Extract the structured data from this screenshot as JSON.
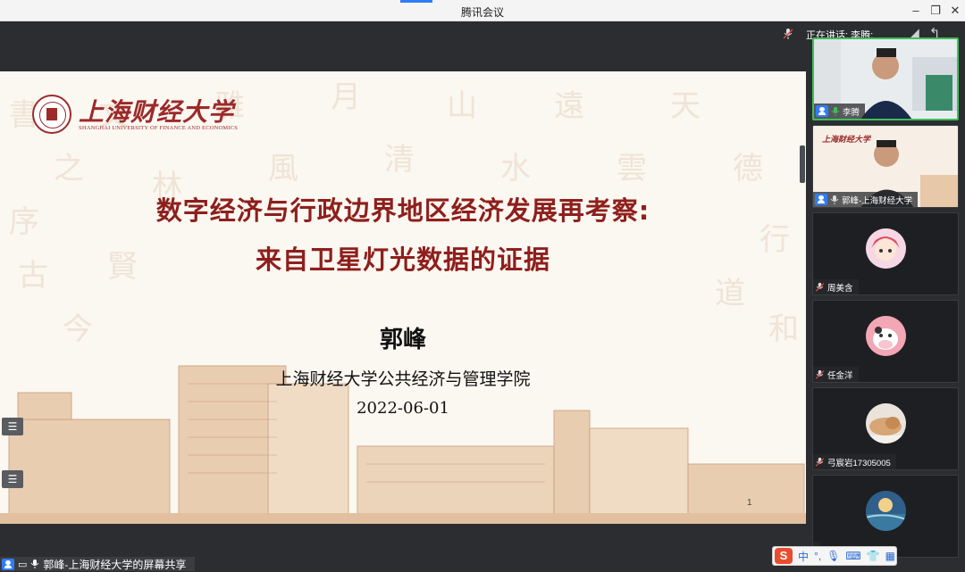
{
  "window": {
    "title": "腾讯会议"
  },
  "toolbar": {
    "speaking_label": "正在讲话: 李腾;"
  },
  "slide": {
    "logo_cn": "上海财经大学",
    "logo_en": "SHANGHAI UNIVERSITY OF FINANCE AND ECONOMICS",
    "title_line1": "数字经济与行政边界地区经济发展再考察:",
    "title_line2": "来自卫星灯光数据的证据",
    "author": "郭峰",
    "institution": "上海财经大学公共经济与管理学院",
    "date": "2022-06-01",
    "page_number": "1"
  },
  "participants": [
    {
      "name": "李腾",
      "kind": "camera",
      "speaking": true
    },
    {
      "name": "郭峰-上海财经大学",
      "kind": "camera",
      "speaking": false
    },
    {
      "name": "周美含",
      "kind": "avatar",
      "avatar": "cartoon-girl"
    },
    {
      "name": "任金洋",
      "kind": "avatar",
      "avatar": "cartoon-cow"
    },
    {
      "name": "弓宸岩17305005",
      "kind": "avatar",
      "avatar": "cat-photo"
    },
    {
      "name": "",
      "kind": "avatar",
      "avatar": "painting"
    }
  ],
  "share_bar": {
    "label": "郭峰-上海财经大学的屏幕共享"
  },
  "ime": {
    "logo": "S",
    "mode": "中"
  },
  "colors": {
    "title_red": "#8e1f1c",
    "accent_blue": "#2f7df6",
    "speaking_green": "#3fbf5a"
  }
}
